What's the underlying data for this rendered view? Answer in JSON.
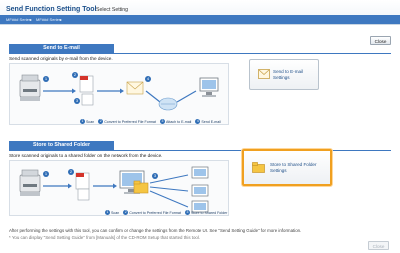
{
  "header": {
    "app_title": "Send Function Setting Tool",
    "mode_label": "Select Setting",
    "breadcrumb": [
      "MF###  Series",
      "MF###  Series"
    ]
  },
  "close_label": "Close",
  "email_section": {
    "title": "Send to E-mail",
    "description": "Send scanned originals by e-mail from the device.",
    "diagram_numbers": [
      "1",
      "2",
      "3",
      "4"
    ],
    "steps": [
      {
        "num": "1",
        "text": "Scan"
      },
      {
        "num": "2",
        "text": "Convert to Preferred File Format"
      },
      {
        "num": "3",
        "text": "Attach to E-mail"
      },
      {
        "num": "4",
        "text": "Send E-mail"
      }
    ],
    "button_label_1": "Send to E-mail",
    "button_label_2": "Settings"
  },
  "folder_section": {
    "title": "Store to Shared Folder",
    "description": "Store scanned originals to a shared folder on the network from the device.",
    "diagram_numbers": [
      "1",
      "2",
      "3"
    ],
    "steps": [
      {
        "num": "1",
        "text": "Scan"
      },
      {
        "num": "2",
        "text": "Convert to Preferred File Format"
      },
      {
        "num": "3",
        "text": "Store to Shared Folder"
      }
    ],
    "button_label_1": "Store to Shared Folder",
    "button_label_2": "Settings"
  },
  "footer": {
    "line1": "After performing the settings with this tool, you can confirm or change the settings from the Remote UI. See \"Send Setting Guide\" for more information.",
    "line2": "* You can display \"Send Setting Guide\" from [Manuals] of the CD-ROM Setup that started this tool."
  },
  "colors": {
    "brand_blue": "#3e78c0",
    "selected_border": "#f0a020"
  },
  "icons": [
    "printer-icon",
    "pdf-document-icon",
    "email-envelope-icon",
    "network-icon",
    "computer-icon",
    "folder-icon",
    "email-icon"
  ]
}
